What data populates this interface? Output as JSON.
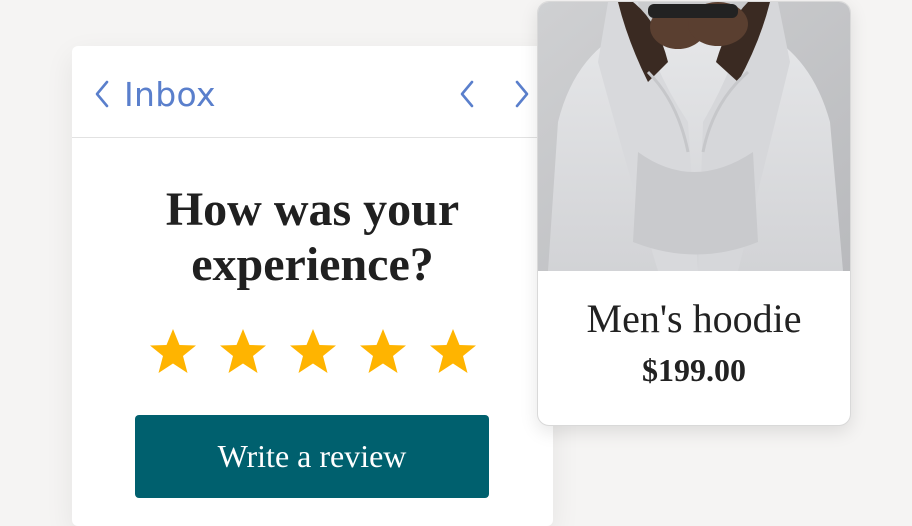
{
  "email": {
    "back_label": "Inbox",
    "heading_line1": "How was your",
    "heading_line2": "experience?",
    "rating": {
      "stars": 5,
      "filled": 5
    },
    "cta_label": "Write a review"
  },
  "product": {
    "name": "Men's hoodie",
    "price": "$199.00"
  },
  "colors": {
    "accent_link": "#5a7fcc",
    "star": "#ffb400",
    "button": "#00606e"
  },
  "icons": {
    "back": "chevron-left-icon",
    "prev": "chevron-left-icon",
    "next": "chevron-right-icon",
    "star": "star-icon"
  }
}
